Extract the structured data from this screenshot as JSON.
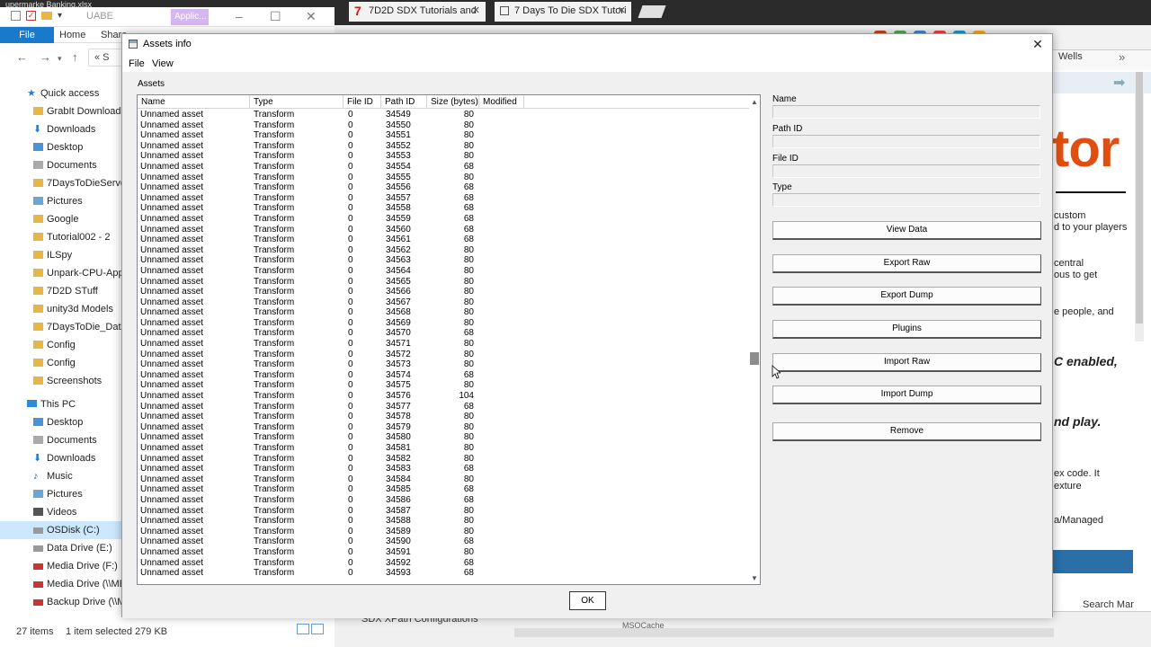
{
  "background": {
    "top_strip_text": "upermarke    Banking.xlsx",
    "explorer": {
      "title": "UABE",
      "context_tab": "Applic...",
      "ribbon_tabs": [
        "File",
        "Home",
        "Share"
      ],
      "address_text": "« S",
      "quick_access": "Quick access",
      "nav_items": [
        {
          "label": "GrabIt Downloads",
          "icon": "folder-icon"
        },
        {
          "label": "Downloads",
          "icon": "downloads-icon"
        },
        {
          "label": "Desktop",
          "icon": "desktop-icon"
        },
        {
          "label": "Documents",
          "icon": "documents-icon"
        },
        {
          "label": "7DaysToDieServer_",
          "icon": "folder-icon"
        },
        {
          "label": "Pictures",
          "icon": "pictures-icon"
        },
        {
          "label": "Google",
          "icon": "folder-icon"
        },
        {
          "label": "Tutorial002 - 2",
          "icon": "folder-icon"
        },
        {
          "label": "ILSpy",
          "icon": "folder-icon"
        },
        {
          "label": "Unpark-CPU-App",
          "icon": "folder-icon"
        },
        {
          "label": "7D2D STuff",
          "icon": "folder-icon"
        },
        {
          "label": "unity3d Models",
          "icon": "folder-icon"
        },
        {
          "label": "7DaysToDie_Data",
          "icon": "folder-icon"
        },
        {
          "label": "Config",
          "icon": "folder-icon"
        },
        {
          "label": "Config",
          "icon": "folder-icon"
        },
        {
          "label": "Screenshots",
          "icon": "folder-icon"
        }
      ],
      "this_pc": "This PC",
      "pc_items": [
        {
          "label": "Desktop",
          "icon": "desktop-icon"
        },
        {
          "label": "Documents",
          "icon": "documents-icon"
        },
        {
          "label": "Downloads",
          "icon": "downloads-icon"
        },
        {
          "label": "Music",
          "icon": "music-icon"
        },
        {
          "label": "Pictures",
          "icon": "pictures-icon"
        },
        {
          "label": "Videos",
          "icon": "videos-icon"
        },
        {
          "label": "OSDisk (C:)",
          "icon": "drive-icon"
        },
        {
          "label": "Data Drive (E:)",
          "icon": "drive-icon"
        },
        {
          "label": "Media Drive (F:)",
          "icon": "network-drive-icon"
        },
        {
          "label": "Media Drive (\\\\ME",
          "icon": "network-drive-icon"
        },
        {
          "label": "Backup Drive (\\\\ME",
          "icon": "network-drive-icon"
        }
      ],
      "status_count": "27 items",
      "status_selected": "1 item selected  279 KB"
    },
    "browser": {
      "tabs": [
        "7D2D SDX Tutorials and",
        "7 Days To Die SDX Tutori"
      ],
      "bookmark_right": "Wells",
      "page_big_text": "tor",
      "page_lines": [
        {
          "text": "custom",
          "style": "n"
        },
        {
          "text": "d to your players",
          "style": "n"
        },
        {
          "text": "central",
          "style": "n"
        },
        {
          "text": "ous to get",
          "style": "n"
        },
        {
          "text": "e people, and",
          "style": "n"
        },
        {
          "text": "C enabled,",
          "style": "bi"
        },
        {
          "text": "nd play.",
          "style": "bi"
        },
        {
          "text": "ex code. It",
          "style": "n"
        },
        {
          "text": "exture",
          "style": "n"
        },
        {
          "text": "a/Managed",
          "style": "n"
        }
      ],
      "bottom_tab": "SDX XPath Configurations",
      "bottom_misc": "MSOCache",
      "search_text": "Search Mar"
    }
  },
  "dialog": {
    "title": "Assets info",
    "menu": [
      "File",
      "View"
    ],
    "group_label": "Assets",
    "columns": [
      "Name",
      "Type",
      "File ID",
      "Path ID",
      "Size (bytes)",
      "Modified"
    ],
    "rows": [
      [
        "Unnamed asset",
        "Transform",
        "0",
        "34549",
        "80"
      ],
      [
        "Unnamed asset",
        "Transform",
        "0",
        "34550",
        "80"
      ],
      [
        "Unnamed asset",
        "Transform",
        "0",
        "34551",
        "80"
      ],
      [
        "Unnamed asset",
        "Transform",
        "0",
        "34552",
        "80"
      ],
      [
        "Unnamed asset",
        "Transform",
        "0",
        "34553",
        "80"
      ],
      [
        "Unnamed asset",
        "Transform",
        "0",
        "34554",
        "68"
      ],
      [
        "Unnamed asset",
        "Transform",
        "0",
        "34555",
        "80"
      ],
      [
        "Unnamed asset",
        "Transform",
        "0",
        "34556",
        "68"
      ],
      [
        "Unnamed asset",
        "Transform",
        "0",
        "34557",
        "68"
      ],
      [
        "Unnamed asset",
        "Transform",
        "0",
        "34558",
        "68"
      ],
      [
        "Unnamed asset",
        "Transform",
        "0",
        "34559",
        "68"
      ],
      [
        "Unnamed asset",
        "Transform",
        "0",
        "34560",
        "68"
      ],
      [
        "Unnamed asset",
        "Transform",
        "0",
        "34561",
        "68"
      ],
      [
        "Unnamed asset",
        "Transform",
        "0",
        "34562",
        "80"
      ],
      [
        "Unnamed asset",
        "Transform",
        "0",
        "34563",
        "80"
      ],
      [
        "Unnamed asset",
        "Transform",
        "0",
        "34564",
        "80"
      ],
      [
        "Unnamed asset",
        "Transform",
        "0",
        "34565",
        "80"
      ],
      [
        "Unnamed asset",
        "Transform",
        "0",
        "34566",
        "80"
      ],
      [
        "Unnamed asset",
        "Transform",
        "0",
        "34567",
        "80"
      ],
      [
        "Unnamed asset",
        "Transform",
        "0",
        "34568",
        "80"
      ],
      [
        "Unnamed asset",
        "Transform",
        "0",
        "34569",
        "80"
      ],
      [
        "Unnamed asset",
        "Transform",
        "0",
        "34570",
        "68"
      ],
      [
        "Unnamed asset",
        "Transform",
        "0",
        "34571",
        "80"
      ],
      [
        "Unnamed asset",
        "Transform",
        "0",
        "34572",
        "80"
      ],
      [
        "Unnamed asset",
        "Transform",
        "0",
        "34573",
        "80"
      ],
      [
        "Unnamed asset",
        "Transform",
        "0",
        "34574",
        "68"
      ],
      [
        "Unnamed asset",
        "Transform",
        "0",
        "34575",
        "80"
      ],
      [
        "Unnamed asset",
        "Transform",
        "0",
        "34576",
        "104"
      ],
      [
        "Unnamed asset",
        "Transform",
        "0",
        "34577",
        "68"
      ],
      [
        "Unnamed asset",
        "Transform",
        "0",
        "34578",
        "80"
      ],
      [
        "Unnamed asset",
        "Transform",
        "0",
        "34579",
        "80"
      ],
      [
        "Unnamed asset",
        "Transform",
        "0",
        "34580",
        "80"
      ],
      [
        "Unnamed asset",
        "Transform",
        "0",
        "34581",
        "80"
      ],
      [
        "Unnamed asset",
        "Transform",
        "0",
        "34582",
        "80"
      ],
      [
        "Unnamed asset",
        "Transform",
        "0",
        "34583",
        "68"
      ],
      [
        "Unnamed asset",
        "Transform",
        "0",
        "34584",
        "80"
      ],
      [
        "Unnamed asset",
        "Transform",
        "0",
        "34585",
        "68"
      ],
      [
        "Unnamed asset",
        "Transform",
        "0",
        "34586",
        "68"
      ],
      [
        "Unnamed asset",
        "Transform",
        "0",
        "34587",
        "80"
      ],
      [
        "Unnamed asset",
        "Transform",
        "0",
        "34588",
        "80"
      ],
      [
        "Unnamed asset",
        "Transform",
        "0",
        "34589",
        "80"
      ],
      [
        "Unnamed asset",
        "Transform",
        "0",
        "34590",
        "68"
      ],
      [
        "Unnamed asset",
        "Transform",
        "0",
        "34591",
        "80"
      ],
      [
        "Unnamed asset",
        "Transform",
        "0",
        "34592",
        "68"
      ],
      [
        "Unnamed asset",
        "Transform",
        "0",
        "34593",
        "68"
      ]
    ],
    "fields": [
      {
        "label": "Name",
        "value": ""
      },
      {
        "label": "Path ID",
        "value": ""
      },
      {
        "label": "File ID",
        "value": ""
      },
      {
        "label": "Type",
        "value": ""
      }
    ],
    "buttons": [
      "View Data",
      "Export Raw",
      "Export Dump",
      "Plugins",
      "Import Raw",
      "Import Dump",
      "Remove"
    ],
    "ok_label": "OK"
  }
}
